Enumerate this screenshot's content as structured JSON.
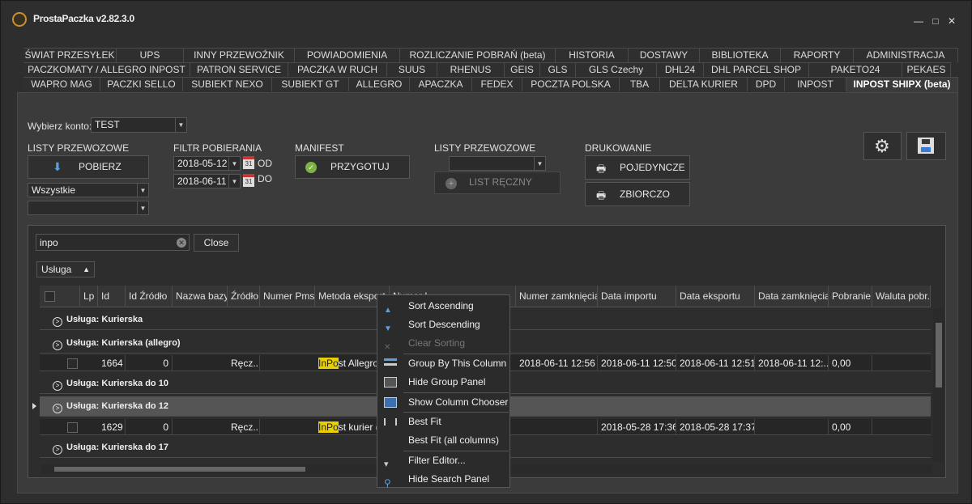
{
  "app": {
    "title": "ProstaPaczka v2.82.3.0"
  },
  "window": {
    "minimize": "—",
    "maximize": "□",
    "close": "✕"
  },
  "tabs": {
    "row1": [
      "ŚWIAT PRZESYŁEK",
      "UPS",
      "INNY PRZEWOŹNIK",
      "POWIADOMIENIA",
      "ROZLICZANIE POBRAŃ (beta)",
      "HISTORIA",
      "DOSTAWY",
      "BIBLIOTEKA",
      "RAPORTY",
      "ADMINISTRACJA"
    ],
    "row2": [
      "PACZKOMATY / ALLEGRO INPOST",
      "PATRON SERVICE",
      "PACZKA W RUCH",
      "SUUS",
      "RHENUS",
      "GEIS",
      "GLS",
      "GLS Czechy",
      "DHL24",
      "DHL PARCEL SHOP",
      "PAKETO24",
      "PEKAES"
    ],
    "row3": [
      "WAPRO MAG",
      "PACZKI SELLO",
      "SUBIEKT NEXO",
      "SUBIEKT GT",
      "ALLEGRO",
      "APACZKA",
      "FEDEX",
      "POCZTA POLSKA",
      "TBA",
      "DELTA KURIER",
      "DPD",
      "INPOST",
      "INPOST SHIPX (beta)"
    ]
  },
  "account": {
    "label": "Wybierz konto:",
    "value": "TEST"
  },
  "sections": {
    "listy1": "LISTY PRZEWOZOWE",
    "pobierz": "POBIERZ",
    "status_filter": "Wszystkie",
    "status_filter2": "",
    "filtr": "FILTR POBIERANIA",
    "date_from": "2018-05-12",
    "od": "OD",
    "date_to": "2018-06-11",
    "do": "DO",
    "cal_day": "31",
    "manifest": "MANIFEST",
    "przygotuj": "PRZYGOTUJ",
    "listy2": "LISTY PRZEWOZOWE",
    "list_combo": "",
    "list_reczny": "LIST RĘCZNY",
    "drukowanie": "DRUKOWANIE",
    "pojedyncze": "POJEDYNCZE",
    "zbiorczo": "ZBIORCZO"
  },
  "search": {
    "value": "inpo",
    "close": "Close"
  },
  "group_panel": {
    "chip": "Usługa"
  },
  "grid": {
    "columns": [
      "",
      "Lp",
      "Id",
      "Id Źródło",
      "Nazwa bazy",
      "Źródło",
      "Numer Pms",
      "Metoda eksport",
      "Numer L...",
      "Numer zamknięcia",
      "Data importu",
      "Data eksportu",
      "Data zamknięcia",
      "Pobranie",
      "Waluta pobr."
    ],
    "groups": [
      "Usługa: Kurierska",
      "Usługa: Kurierska (allegro)",
      "Usługa: Kurierska do 10",
      "Usługa: Kurierska do 12",
      "Usługa: Kurierska do 17"
    ],
    "row1": {
      "id": "1664",
      "id_zrodlo": "0",
      "zrodlo": "Ręcz...",
      "metoda_hl": "InPo",
      "metoda_rest": "st Allegro...",
      "numer_zamk": "2018-06-11 12:56",
      "data_importu": "2018-06-11 12:50",
      "data_eksportu": "2018-06-11 12:51",
      "data_zamk": "2018-06-11 12:...",
      "pobranie": "0,00"
    },
    "row2": {
      "id": "1629",
      "id_zrodlo": "0",
      "zrodlo": "Ręcz...",
      "metoda_hl": "InPo",
      "metoda_rest": "st kurier (S...",
      "numer_zamk": "",
      "data_importu": "2018-05-28 17:36",
      "data_eksportu": "2018-05-28 17:37",
      "data_zamk": "",
      "pobranie": "0,00"
    }
  },
  "context_menu": [
    "Sort Ascending",
    "Sort Descending",
    "Clear Sorting",
    "Group By This Column",
    "Hide Group Panel",
    "Show Column Chooser",
    "Best Fit",
    "Best Fit (all columns)",
    "Filter Editor...",
    "Hide Search Panel"
  ],
  "colors": {
    "bg": "#2e2e2e",
    "panel": "#3b3b3b",
    "highlight": "#e8d000",
    "selected_group": "#555555"
  }
}
